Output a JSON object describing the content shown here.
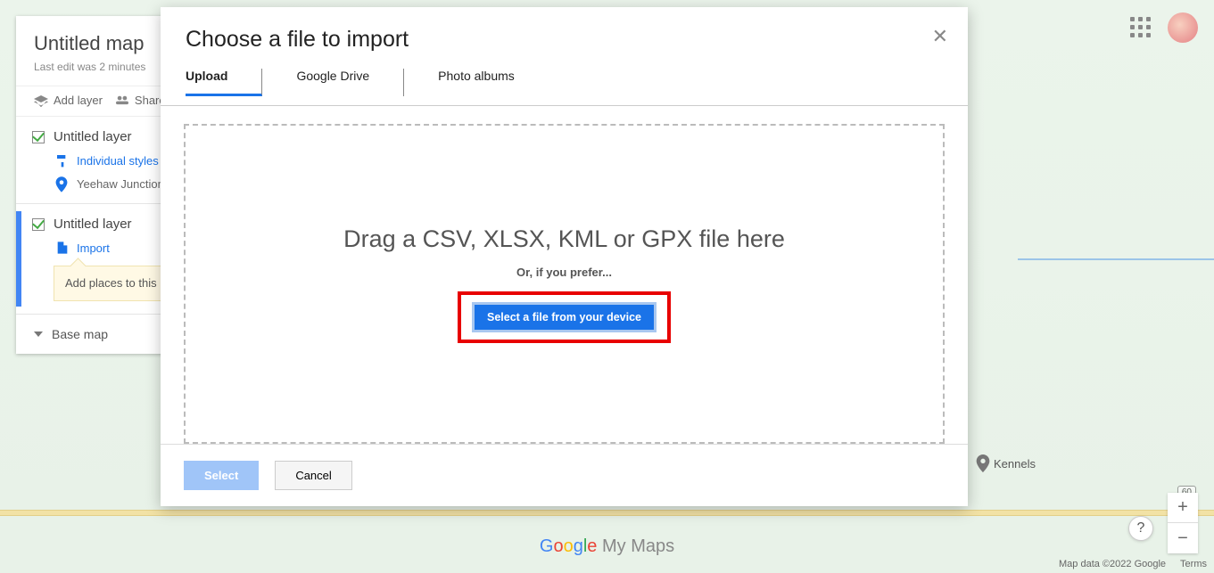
{
  "panel": {
    "title": "Untitled map",
    "subtitle": "Last edit was 2 minutes",
    "toolbar": {
      "add_layer": "Add layer",
      "share": "Share"
    },
    "layer1": {
      "name": "Untitled layer",
      "style": "Individual styles",
      "place": "Yeehaw Junction"
    },
    "layer2": {
      "name": "Untitled layer",
      "import": "Import",
      "note": "Add places to this importing data."
    },
    "basemap": "Base map"
  },
  "modal": {
    "title": "Choose a file to import",
    "tabs": {
      "upload": "Upload",
      "drive": "Google Drive",
      "photos": "Photo albums"
    },
    "drop_head": "Drag a CSV, XLSX, KML or GPX file here",
    "drop_sub": "Or, if you prefer...",
    "file_btn": "Select a file from your device",
    "select": "Select",
    "cancel": "Cancel"
  },
  "logo": {
    "google": [
      "G",
      "o",
      "o",
      "g",
      "l",
      "e"
    ],
    "mymaps": " My Maps"
  },
  "credit": {
    "data": "Map data ©2022 Google",
    "terms": "Terms"
  },
  "poi_label": "Kennels",
  "shield": "60"
}
